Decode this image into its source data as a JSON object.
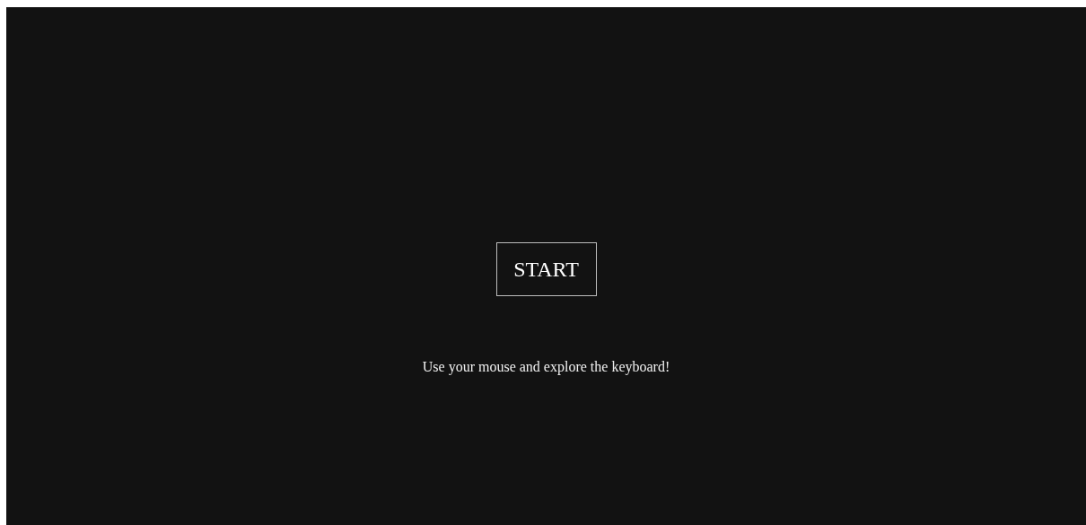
{
  "start_button": {
    "label": "START"
  },
  "hint": "Use your mouse and explore the keyboard!"
}
